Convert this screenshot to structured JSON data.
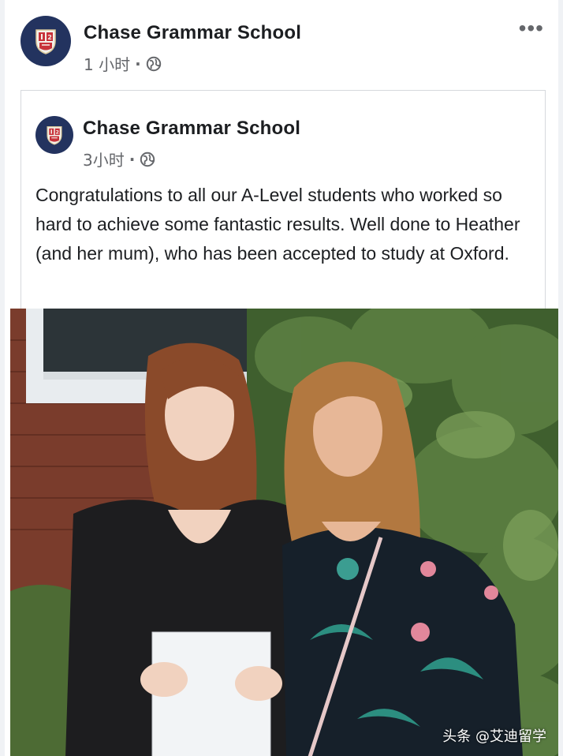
{
  "post": {
    "author": "Chase Grammar School",
    "time": "1 小时",
    "separator": "·",
    "privacy_icon": "globe-icon",
    "more_label": "•••"
  },
  "shared_post": {
    "author": "Chase Grammar School",
    "time": "3小时",
    "separator": "·",
    "privacy_icon": "globe-icon",
    "text": "Congratulations to all our A-Level students who worked so hard to achieve some fantastic results. Well done to Heather (and her mum), who has been accepted to study at Oxford."
  },
  "photo": {
    "watermark": "头条 @艾迪留学"
  },
  "colors": {
    "avatar_bg": "#23335f",
    "crest_red": "#c8323a",
    "text_primary": "#1c1e21",
    "text_secondary": "#65676b",
    "border": "#d6d9dd"
  }
}
